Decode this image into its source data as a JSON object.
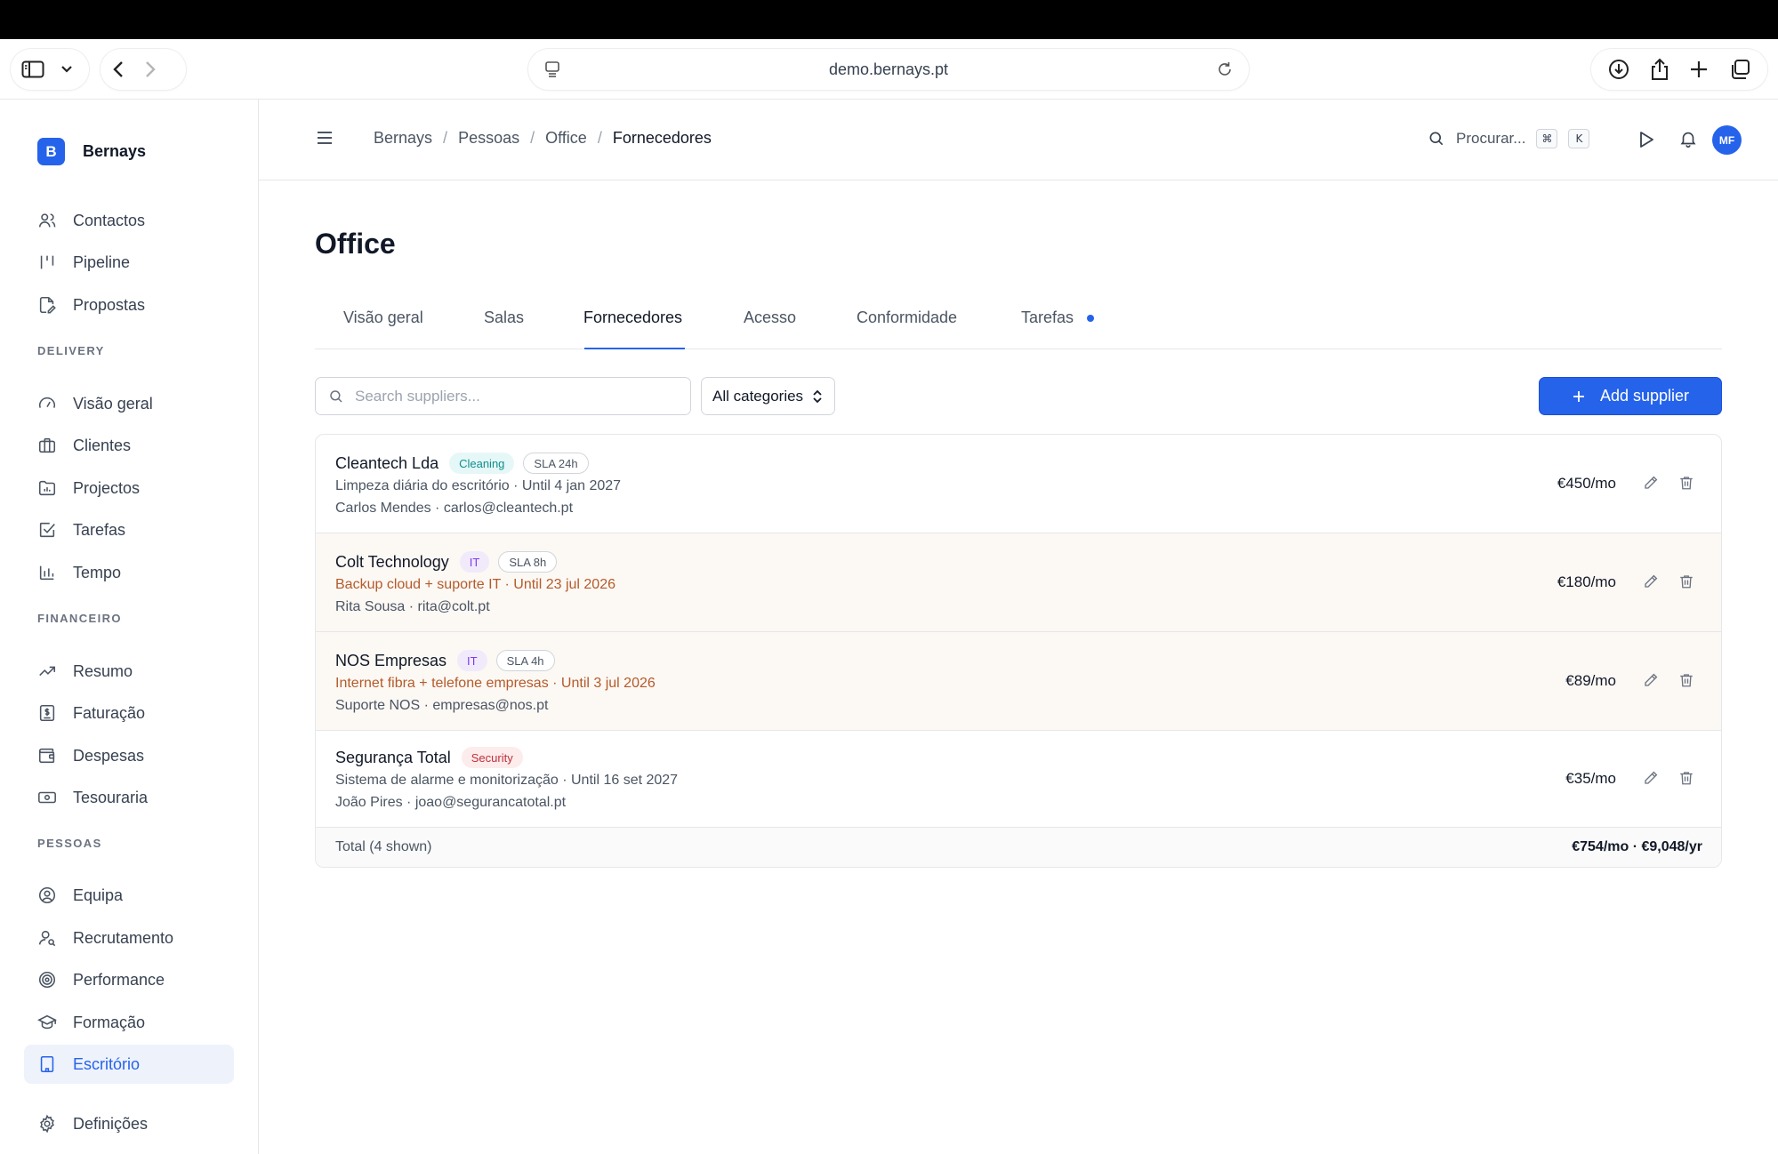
{
  "browser": {
    "url": "demo.bernays.pt"
  },
  "sidebar": {
    "brand_initial": "B",
    "brand_name": "Bernays",
    "items_top": [
      {
        "label": "Contactos",
        "icon": "users-icon"
      },
      {
        "label": "Pipeline",
        "icon": "kanban-icon"
      },
      {
        "label": "Propostas",
        "icon": "document-edit-icon"
      }
    ],
    "section_delivery": "DELIVERY",
    "items_delivery": [
      {
        "label": "Visão geral",
        "icon": "gauge-icon"
      },
      {
        "label": "Clientes",
        "icon": "briefcase-icon"
      },
      {
        "label": "Projectos",
        "icon": "folder-chart-icon"
      },
      {
        "label": "Tarefas",
        "icon": "checkbox-icon"
      },
      {
        "label": "Tempo",
        "icon": "bar-chart-icon"
      }
    ],
    "section_financeiro": "FINANCEIRO",
    "items_financeiro": [
      {
        "label": "Resumo",
        "icon": "trend-up-icon"
      },
      {
        "label": "Faturação",
        "icon": "invoice-icon"
      },
      {
        "label": "Despesas",
        "icon": "wallet-icon"
      },
      {
        "label": "Tesouraria",
        "icon": "banknote-icon"
      }
    ],
    "section_pessoas": "PESSOAS",
    "items_pessoas": [
      {
        "label": "Equipa",
        "icon": "user-circle-icon"
      },
      {
        "label": "Recrutamento",
        "icon": "user-search-icon"
      },
      {
        "label": "Performance",
        "icon": "target-icon"
      },
      {
        "label": "Formação",
        "icon": "graduation-cap-icon"
      },
      {
        "label": "Escritório",
        "icon": "building-icon"
      }
    ],
    "settings_label": "Definições"
  },
  "topbar": {
    "breadcrumb": [
      "Bernays",
      "Pessoas",
      "Office",
      "Fornecedores"
    ],
    "search_label": "Procurar...",
    "kbd_cmd": "⌘",
    "kbd_k": "K",
    "avatar_initials": "MF"
  },
  "page": {
    "title": "Office",
    "tabs": [
      "Visão geral",
      "Salas",
      "Fornecedores",
      "Acesso",
      "Conformidade",
      "Tarefas"
    ],
    "active_tab": "Fornecedores"
  },
  "toolbar": {
    "search_placeholder": "Search suppliers...",
    "category_select": "All categories",
    "add_label": "Add supplier"
  },
  "suppliers": [
    {
      "name": "Cleantech Lda",
      "category": "Cleaning",
      "sla": "SLA 24h",
      "description": "Limpeza diária do escritório · Until 4 jan 2027",
      "contact": "Carlos Mendes · carlos@cleantech.pt",
      "price": "€450/mo"
    },
    {
      "name": "Colt Technology",
      "category": "IT",
      "sla": "SLA 8h",
      "description": "Backup cloud + suporte IT · Until 23 jul 2026",
      "contact": "Rita Sousa · rita@colt.pt",
      "price": "€180/mo"
    },
    {
      "name": "NOS Empresas",
      "category": "IT",
      "sla": "SLA 4h",
      "description": "Internet fibra + telefone empresas · Until 3 jul 2026",
      "contact": "Suporte NOS · empresas@nos.pt",
      "price": "€89/mo"
    },
    {
      "name": "Segurança Total",
      "category": "Security",
      "description": "Sistema de alarme e monitorização · Until 16 set 2027",
      "contact": "João Pires · joao@segurancatotal.pt",
      "price": "€35/mo"
    }
  ],
  "total": {
    "label": "Total (4 shown)",
    "value": "€754/mo · €9,048/yr"
  },
  "colors": {
    "accent": "#2563eb",
    "warning_text": "#b45b2a",
    "warning_row_bg": "#fcf8f4"
  }
}
